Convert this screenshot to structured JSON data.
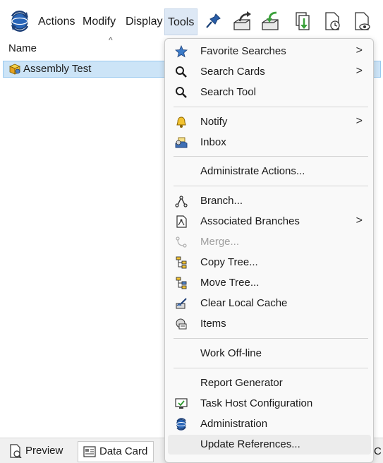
{
  "menubar": {
    "items": [
      {
        "label": "Actions"
      },
      {
        "label": "Modify"
      },
      {
        "label": "Display"
      },
      {
        "label": "Tools"
      }
    ]
  },
  "list": {
    "column_name": "Name",
    "sort_arrow": "^",
    "rows": [
      {
        "label": "Assembly Test"
      }
    ]
  },
  "tools_menu": {
    "items": [
      {
        "label": "Favorite Searches",
        "icon": "star-icon",
        "submenu": true
      },
      {
        "label": "Search Cards",
        "icon": "magnifier-icon",
        "submenu": true
      },
      {
        "label": "Search Tool",
        "icon": "magnifier-icon"
      },
      {
        "label": "Notify",
        "icon": "bell-icon",
        "submenu": true
      },
      {
        "label": "Inbox",
        "icon": "inbox-icon"
      },
      {
        "label": "Administrate Actions...",
        "icon": ""
      },
      {
        "label": "Branch...",
        "icon": "branch-icon"
      },
      {
        "label": "Associated Branches",
        "icon": "associated-branches-icon",
        "submenu": true
      },
      {
        "label": "Merge...",
        "icon": "merge-icon",
        "disabled": true
      },
      {
        "label": "Copy Tree...",
        "icon": "copy-tree-icon"
      },
      {
        "label": "Move Tree...",
        "icon": "move-tree-icon"
      },
      {
        "label": "Clear Local Cache",
        "icon": "clear-cache-icon"
      },
      {
        "label": "Items",
        "icon": "items-icon"
      },
      {
        "label": "Work Off-line",
        "icon": ""
      },
      {
        "label": "Report Generator",
        "icon": ""
      },
      {
        "label": "Task Host Configuration",
        "icon": "monitor-icon"
      },
      {
        "label": "Administration",
        "icon": "administration-icon"
      },
      {
        "label": "Update References...",
        "icon": ""
      }
    ],
    "chevron": ">"
  },
  "bottom_tabs": {
    "items": [
      {
        "label": "Preview"
      },
      {
        "label": "Data Card"
      }
    ],
    "trailing": "C"
  },
  "colors": {
    "selection": "#cce4f7",
    "active_menu": "#dde8f5",
    "menu_bg": "#f9f9f9",
    "disabled_text": "#a0a0a0"
  }
}
